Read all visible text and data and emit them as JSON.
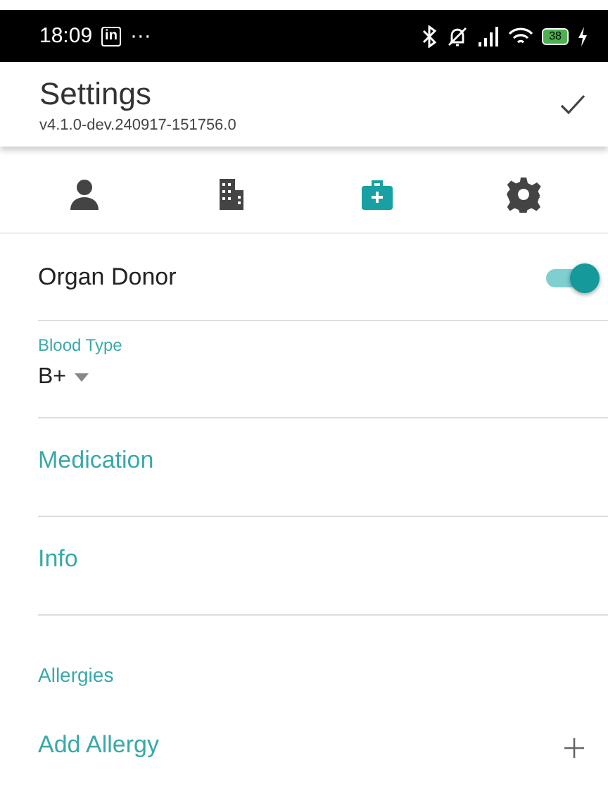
{
  "status_bar": {
    "time": "18:09",
    "app_badge": "in",
    "more": "···",
    "battery": "38"
  },
  "app_bar": {
    "title": "Settings",
    "subtitle": "v4.1.0-dev.240917-151756.0"
  },
  "tabs": [
    {
      "kind": "person",
      "selected": false
    },
    {
      "kind": "building",
      "selected": false
    },
    {
      "kind": "medkit",
      "selected": true
    },
    {
      "kind": "gear",
      "selected": false
    }
  ],
  "organ_donor": {
    "label": "Organ Donor",
    "on": true
  },
  "blood_type": {
    "label": "Blood Type",
    "value": "B+"
  },
  "links": [
    "Medication",
    "Info"
  ],
  "allergies": {
    "header": "Allergies",
    "add_label": "Add Allergy"
  }
}
